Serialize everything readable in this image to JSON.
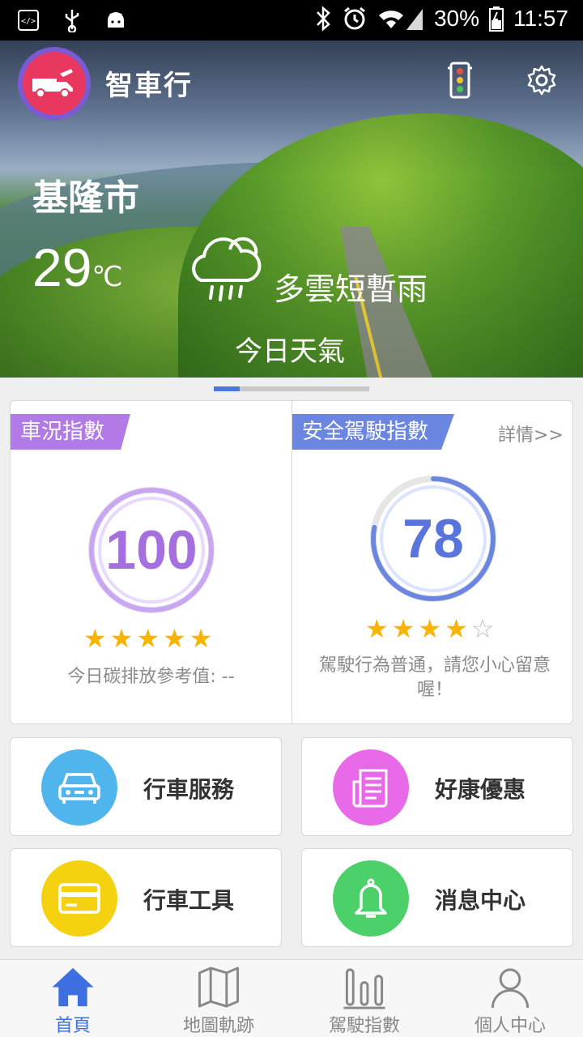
{
  "status": {
    "battery": "30%",
    "time": "11:57"
  },
  "header": {
    "title": "智車行"
  },
  "weather": {
    "city": "基隆市",
    "temperature": "29",
    "unit": "℃",
    "description": "多雲短暫雨",
    "caption": "今日天氣"
  },
  "pager": {
    "pages": 6,
    "active": 1
  },
  "car_index": {
    "title": "車況指數",
    "score": "100",
    "stars": 5,
    "note": "今日碳排放參考值: --",
    "color": "#a56fe0"
  },
  "safety_index": {
    "title": "安全駕駛指數",
    "detail_link": "詳情>>",
    "score": "78",
    "stars": 4,
    "note": "駕駛行為普通，請您小心留意喔！",
    "color": "#5a74de"
  },
  "tiles": [
    {
      "label": "行車服務",
      "icon": "car-icon",
      "color": "#4fb5ec"
    },
    {
      "label": "好康優惠",
      "icon": "newspaper-icon",
      "color": "#e86ae8"
    },
    {
      "label": "行車工具",
      "icon": "card-icon",
      "color": "#f4d20f"
    },
    {
      "label": "消息中心",
      "icon": "bell-icon",
      "color": "#4cd06a"
    }
  ],
  "bottom_nav": [
    {
      "label": "首頁",
      "icon": "home-icon",
      "active": true
    },
    {
      "label": "地圖軌跡",
      "icon": "map-icon",
      "active": false
    },
    {
      "label": "駕駛指數",
      "icon": "bar-chart-icon",
      "active": false
    },
    {
      "label": "個人中心",
      "icon": "person-icon",
      "active": false
    }
  ]
}
